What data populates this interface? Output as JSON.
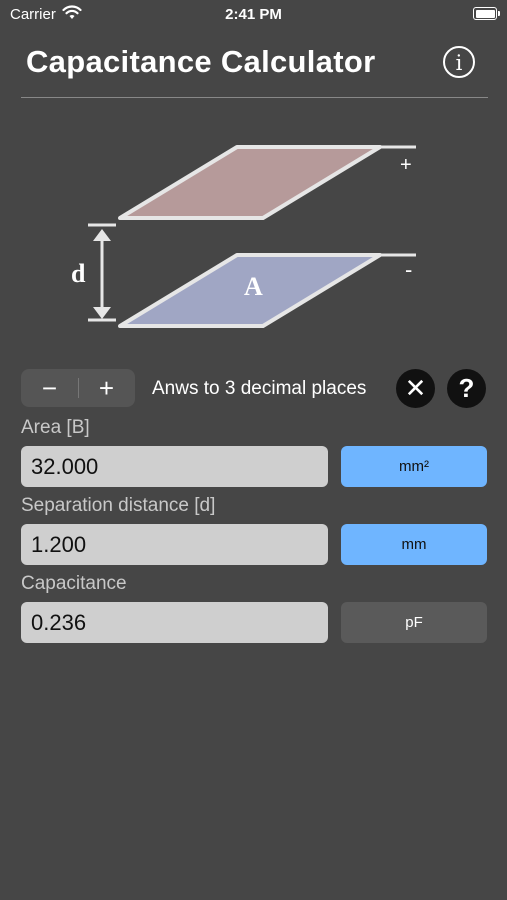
{
  "status_bar": {
    "carrier": "Carrier",
    "time": "2:41 PM"
  },
  "header": {
    "title": "Capacitance Calculator",
    "info_icon": "info-icon"
  },
  "diagram": {
    "plus_label": "+",
    "minus_label": "-",
    "distance_label": "d",
    "area_label": "A",
    "colors": {
      "top_plate": "#b69a9a",
      "bottom_plate": "#a0a6c4"
    }
  },
  "controls": {
    "minus_label": "−",
    "plus_label": "+",
    "decimal_text": "Anws to 3 decimal places",
    "clear_icon": "✕",
    "help_icon": "?"
  },
  "fields": {
    "area": {
      "label": "Area [B]",
      "value": "32.000",
      "unit": "mm²"
    },
    "separation": {
      "label": "Separation distance [d]",
      "value": "1.200",
      "unit": "mm"
    },
    "capacitance": {
      "label": "Capacitance",
      "value": "0.236",
      "unit": "pF"
    }
  },
  "colors": {
    "background": "#464646",
    "accent": "#6fb5ff"
  }
}
